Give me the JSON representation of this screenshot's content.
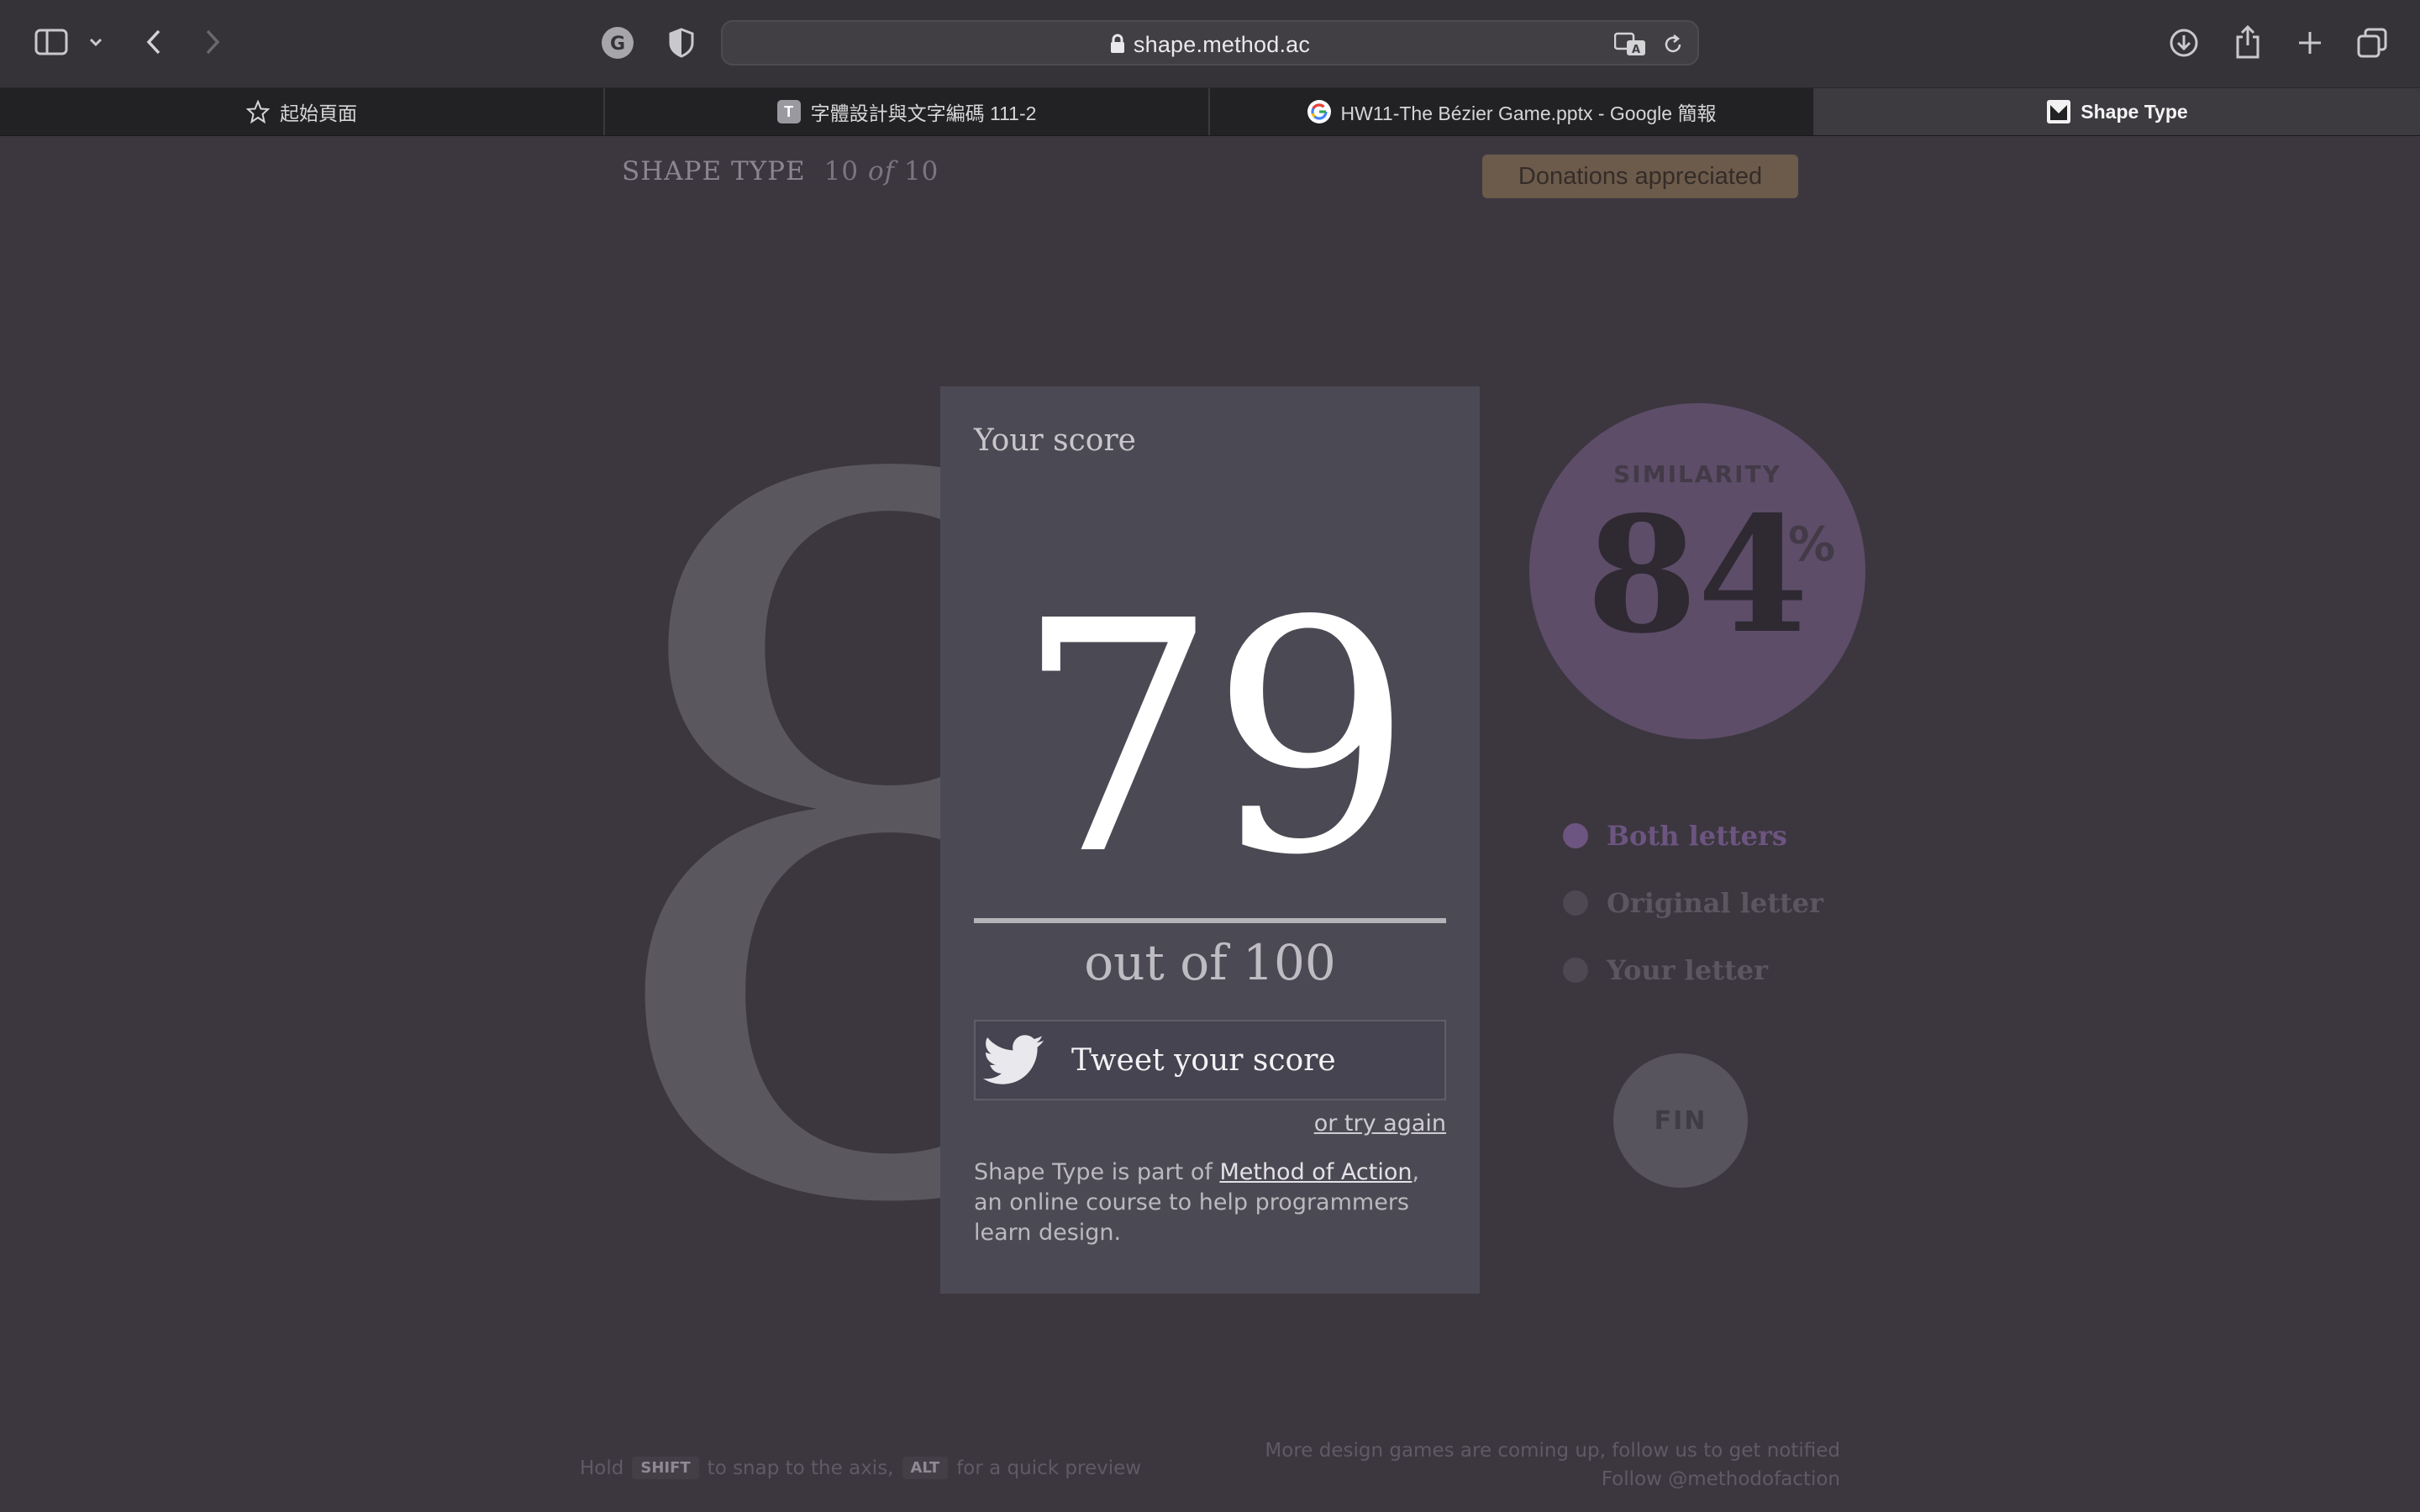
{
  "browser": {
    "url": "shape.method.ac",
    "tabs": [
      {
        "label": "起始頁面",
        "icon": "star-icon",
        "active": false
      },
      {
        "label": "字體設計與文字編碼 111-2",
        "icon": "T",
        "active": false
      },
      {
        "label": "HW11-The Bézier Game.pptx - Google 簡報",
        "icon": "google-icon",
        "active": false
      },
      {
        "label": "Shape Type",
        "icon": "method-icon",
        "active": true
      }
    ]
  },
  "page": {
    "brand": "SHAPE TYPE",
    "counter_current": "10",
    "counter_of": "of",
    "counter_total": "10",
    "donate_label": "Donations appreciated",
    "letter": "8"
  },
  "scorecard": {
    "title": "Your score",
    "score": "79",
    "out_of": "out of 100",
    "tweet_label": "Tweet your score",
    "retry_label": "or try again",
    "about_prefix": "Shape Type is part of ",
    "about_link": "Method of Action",
    "about_suffix": ", an online course to help programmers learn design."
  },
  "similarity": {
    "label": "SIMILARITY",
    "value": "84",
    "unit": "%"
  },
  "view_options": [
    {
      "label": "Both letters",
      "selected": true
    },
    {
      "label": "Original letter",
      "selected": false
    },
    {
      "label": "Your letter",
      "selected": false
    }
  ],
  "fin_label": "FIN",
  "footer": {
    "hint_hold": "Hold",
    "key_shift": "SHIFT",
    "hint_snap": "to snap to the axis,",
    "key_alt": "ALT",
    "hint_preview": "for a quick preview",
    "follow_line1": "More design games are coming up, follow us to get notified",
    "follow_line2": "Follow @methodofaction"
  },
  "colors": {
    "page_bg": "#3c373f",
    "card_bg": "#4b4a54",
    "accent_purple": "#6c5580",
    "donate_bg": "#6c5b4b"
  }
}
